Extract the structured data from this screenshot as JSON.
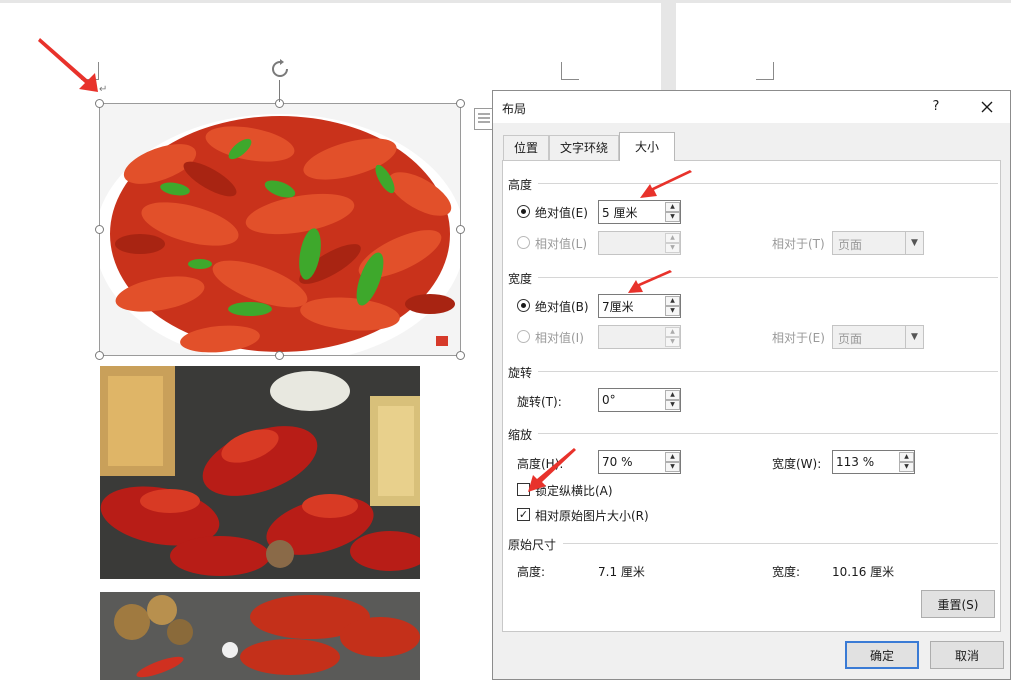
{
  "dialog": {
    "title": "布局",
    "help_label": "?",
    "tabs": [
      {
        "label": "位置",
        "active": false
      },
      {
        "label": "文字环绕",
        "active": false
      },
      {
        "label": "大小",
        "active": true
      }
    ],
    "height_section": {
      "title": "高度",
      "absolute_label": "绝对值(E)",
      "absolute_value": "5 厘米",
      "relative_label": "相对值(L)",
      "relative_value": "",
      "relative_to_label": "相对于(T)",
      "relative_to_value": "页面"
    },
    "width_section": {
      "title": "宽度",
      "absolute_label": "绝对值(B)",
      "absolute_value": "7厘米",
      "relative_label": "相对值(I)",
      "relative_value": "",
      "relative_to_label": "相对于(E)",
      "relative_to_value": "页面"
    },
    "rotate_section": {
      "title": "旋转",
      "rotate_label": "旋转(T):",
      "rotate_value": "0°"
    },
    "scale_section": {
      "title": "缩放",
      "height_label": "高度(H):",
      "height_value": "70 %",
      "width_label": "宽度(W):",
      "width_value": "113 %",
      "lock_aspect_label": "锁定纵横比(A)",
      "lock_aspect_checked": false,
      "relative_original_label": "相对原始图片大小(R)",
      "relative_original_checked": true
    },
    "original_section": {
      "title": "原始尺寸",
      "height_label": "高度:",
      "height_value": "7.1 厘米",
      "width_label": "宽度:",
      "width_value": "10.16 厘米"
    },
    "reset_label": "重置(S)",
    "ok_label": "确定",
    "cancel_label": "取消"
  },
  "colors": {
    "accent": "#3a7bd5",
    "annotation_red": "#e8322b",
    "crayfish": "#d9381e",
    "pepper": "#3ea82c"
  }
}
